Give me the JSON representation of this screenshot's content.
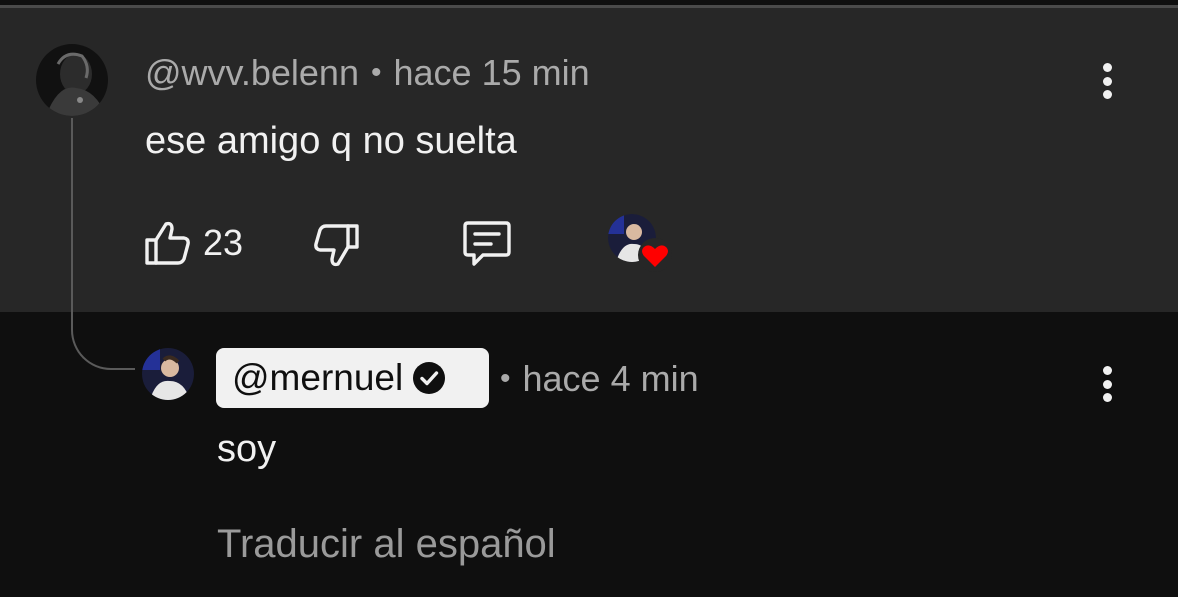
{
  "comment": {
    "author": "@wvv.belenn",
    "time": "hace 15 min",
    "separator": "•",
    "text": "ese amigo q no suelta",
    "likes": "23"
  },
  "reply": {
    "author": "@mernuel",
    "separator": "•",
    "time": "hace 4 min",
    "text": "soy",
    "translate_label": "Traducir al español"
  },
  "icons": {
    "like": "thumbs-up-icon",
    "dislike": "thumbs-down-icon",
    "reply": "comment-icon",
    "more": "more-vert-icon",
    "verified": "verified-check-icon",
    "creator_heart": "heart-icon"
  },
  "colors": {
    "comment_bg": "#272727",
    "page_bg": "#0f0f0f",
    "heart": "#ff0000",
    "author_chip": "#f1f1f1"
  }
}
